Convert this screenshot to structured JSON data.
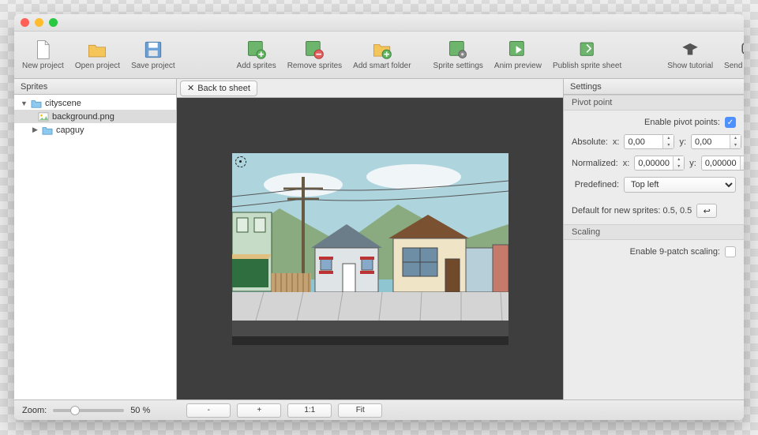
{
  "toolbar": {
    "new_project": "New project",
    "open_project": "Open project",
    "save_project": "Save project",
    "add_sprites": "Add sprites",
    "remove_sprites": "Remove sprites",
    "add_smart_folder": "Add smart folder",
    "sprite_settings": "Sprite settings",
    "anim_preview": "Anim preview",
    "publish_sprite_sheet": "Publish sprite sheet",
    "show_tutorial": "Show tutorial",
    "send_feedback": "Send feedback"
  },
  "sidebar": {
    "header": "Sprites",
    "root": "cityscene",
    "item_background": "background.png",
    "item_capguy": "capguy"
  },
  "main": {
    "back_to_sheet": "Back to sheet"
  },
  "settings": {
    "header": "Settings",
    "pivot_header": "Pivot point",
    "enable_pivot_label": "Enable pivot points:",
    "absolute_label": "Absolute:",
    "normalized_label": "Normalized:",
    "x_label": "x:",
    "y_label": "y:",
    "abs_x": "0,00",
    "abs_y": "0,00",
    "norm_x": "0,00000",
    "norm_y": "0,00000",
    "predefined_label": "Predefined:",
    "predefined_value": "Top left",
    "default_label": "Default for new sprites: 0.5, 0.5",
    "scaling_header": "Scaling",
    "enable_9patch_label": "Enable 9-patch scaling:"
  },
  "bottom": {
    "zoom_label": "Zoom:",
    "zoom_value": "50 %",
    "minus": "-",
    "plus": "+",
    "one": "1:1",
    "fit": "Fit"
  }
}
